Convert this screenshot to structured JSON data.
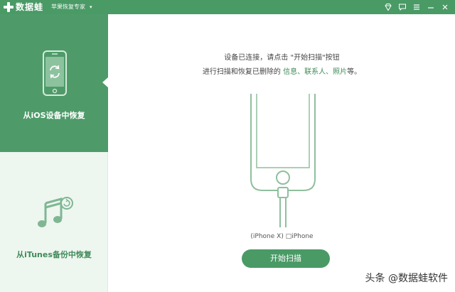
{
  "titlebar": {
    "app_name": "数据蛙",
    "subtitle": "苹果恢复专家",
    "caret": "▾",
    "icons": [
      "diamond-icon",
      "message-icon",
      "menu-icon",
      "minimize-icon",
      "close-icon"
    ]
  },
  "sidebar": {
    "items": [
      {
        "label": "从iOS设备中恢复",
        "icon": "phone-restore-icon",
        "active": true
      },
      {
        "label": "从iTunes备份中恢复",
        "icon": "itunes-music-icon",
        "active": false
      }
    ]
  },
  "main": {
    "instruction_line1": "设备已连接，请点击 \"开始扫描\"按钮",
    "instruction_line2_prefix": "进行扫描和恢复已删除的 ",
    "instruction_line2_highlight": "信息、联系人、照片",
    "instruction_line2_suffix": "等。",
    "device_label": "(iPhone X) □iPhone",
    "start_button": "开始扫描"
  },
  "watermark": "头条 @数据蛙软件",
  "colors": {
    "accent": "#4a9a66",
    "sidebar_bg": "#eef6f0",
    "highlight_text": "#3f8a58"
  }
}
